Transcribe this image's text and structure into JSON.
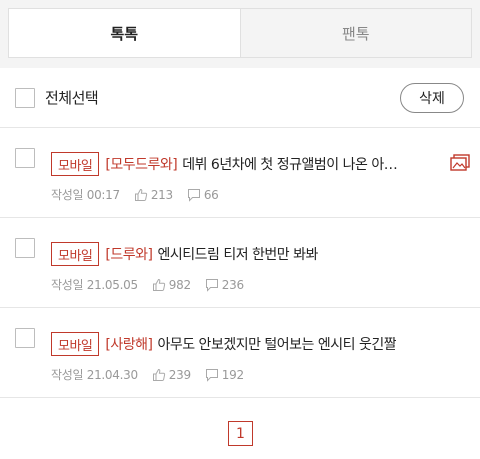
{
  "tabs": [
    {
      "label": "톡톡",
      "active": true
    },
    {
      "label": "팬톡",
      "active": false
    }
  ],
  "toolbar": {
    "select_all_label": "전체선택",
    "delete_label": "삭제"
  },
  "posts": [
    {
      "badge": "모바일",
      "category": "[모두드루와]",
      "title": "데뷔 6년차에 첫 정규앨범이 나온 아…",
      "date": "작성일 00:17",
      "likes": "213",
      "comments": "66",
      "has_image": true
    },
    {
      "badge": "모바일",
      "category": "[드루와]",
      "title": "엔시티드림 티저 한번만 봐봐",
      "date": "작성일 21.05.05",
      "likes": "982",
      "comments": "236",
      "has_image": false
    },
    {
      "badge": "모바일",
      "category": "[사랑해]",
      "title": "아무도 안보겠지만 털어보는 엔시티 웃긴짤",
      "date": "작성일 21.04.30",
      "likes": "239",
      "comments": "192",
      "has_image": false
    }
  ],
  "pagination": {
    "current": "1"
  },
  "colors": {
    "accent": "#c0392b",
    "meta": "#999999",
    "divider": "#e6e6e6"
  },
  "icons": {
    "like": "thumbs-up-icon",
    "comment": "comment-icon",
    "image": "image-icon"
  }
}
